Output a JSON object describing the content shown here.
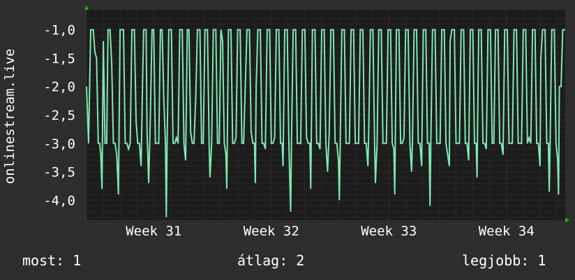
{
  "chart_data": {
    "type": "line",
    "ylabel": "onlinestream.live",
    "ylim": [
      -4.35,
      -0.65
    ],
    "yticks": [
      {
        "value": -1.0,
        "label": "-1,0"
      },
      {
        "value": -1.5,
        "label": "-1,5"
      },
      {
        "value": -2.0,
        "label": "-2,0"
      },
      {
        "value": -2.5,
        "label": "-2,5"
      },
      {
        "value": -3.0,
        "label": "-3,0"
      },
      {
        "value": -3.5,
        "label": "-3,5"
      },
      {
        "value": -4.0,
        "label": "-4,0"
      }
    ],
    "xlim": [
      0,
      28.5
    ],
    "xticks": [
      {
        "value": 4,
        "label": "Week 31"
      },
      {
        "value": 11,
        "label": "Week 32"
      },
      {
        "value": 18,
        "label": "Week 33"
      },
      {
        "value": 25,
        "label": "Week 34"
      }
    ],
    "grid": true,
    "colors": {
      "background": "#2d2d2d",
      "plot_background": "#1c1c1c",
      "line": "#7fe8b2",
      "grid_major": "#6b2a2a",
      "grid_minor": "#3a3a3a",
      "axis_arrow": "#00cc00"
    },
    "series": [
      {
        "values": [
          [
            0.0,
            -2.0
          ],
          [
            0.12,
            -3.0
          ],
          [
            0.25,
            -1.0
          ],
          [
            0.4,
            -1.0
          ],
          [
            0.5,
            -1.4
          ],
          [
            0.6,
            -1.5
          ],
          [
            0.7,
            -3.0
          ],
          [
            0.78,
            -3.0
          ],
          [
            0.85,
            -3.2
          ],
          [
            0.92,
            -3.8
          ],
          [
            1.0,
            -1.2
          ],
          [
            1.1,
            -3.0
          ],
          [
            1.2,
            -3.0
          ],
          [
            1.28,
            -1.0
          ],
          [
            1.4,
            -1.0
          ],
          [
            1.5,
            -1.6
          ],
          [
            1.6,
            -3.0
          ],
          [
            1.7,
            -3.0
          ],
          [
            1.8,
            -3.2
          ],
          [
            1.9,
            -3.9
          ],
          [
            2.0,
            -1.0
          ],
          [
            2.2,
            -1.0
          ],
          [
            2.3,
            -3.0
          ],
          [
            2.4,
            -3.0
          ],
          [
            2.5,
            -3.1
          ],
          [
            2.6,
            -3.0
          ],
          [
            2.7,
            -1.0
          ],
          [
            2.85,
            -1.0
          ],
          [
            2.95,
            -2.6
          ],
          [
            3.05,
            -3.0
          ],
          [
            3.15,
            -3.0
          ],
          [
            3.25,
            -3.4
          ],
          [
            3.32,
            -2.2
          ],
          [
            3.4,
            -1.0
          ],
          [
            3.55,
            -1.0
          ],
          [
            3.6,
            -2.8
          ],
          [
            3.7,
            -3.7
          ],
          [
            3.8,
            -2.5
          ],
          [
            3.9,
            -1.0
          ],
          [
            4.0,
            -1.0
          ],
          [
            4.1,
            -3.0
          ],
          [
            4.2,
            -3.0
          ],
          [
            4.3,
            -3.0
          ],
          [
            4.4,
            -1.0
          ],
          [
            4.5,
            -1.0
          ],
          [
            4.6,
            -2.2
          ],
          [
            4.7,
            -3.0
          ],
          [
            4.75,
            -4.3
          ],
          [
            4.8,
            -3.0
          ],
          [
            4.9,
            -1.0
          ],
          [
            5.05,
            -1.0
          ],
          [
            5.15,
            -3.0
          ],
          [
            5.25,
            -3.0
          ],
          [
            5.35,
            -2.9
          ],
          [
            5.45,
            -3.0
          ],
          [
            5.55,
            -1.0
          ],
          [
            5.7,
            -1.0
          ],
          [
            5.8,
            -3.0
          ],
          [
            5.9,
            -3.3
          ],
          [
            6.0,
            -1.0
          ],
          [
            6.1,
            -1.0
          ],
          [
            6.2,
            -2.8
          ],
          [
            6.3,
            -3.0
          ],
          [
            6.4,
            -3.0
          ],
          [
            6.5,
            -2.2
          ],
          [
            6.6,
            -1.0
          ],
          [
            6.75,
            -1.0
          ],
          [
            6.85,
            -3.0
          ],
          [
            6.95,
            -3.0
          ],
          [
            7.05,
            -1.0
          ],
          [
            7.2,
            -1.0
          ],
          [
            7.3,
            -3.0
          ],
          [
            7.35,
            -3.6
          ],
          [
            7.45,
            -3.0
          ],
          [
            7.55,
            -1.0
          ],
          [
            7.7,
            -1.0
          ],
          [
            7.8,
            -3.0
          ],
          [
            7.9,
            -3.0
          ],
          [
            8.0,
            -1.0
          ],
          [
            8.1,
            -1.2
          ],
          [
            8.2,
            -3.0
          ],
          [
            8.3,
            -3.2
          ],
          [
            8.35,
            -3.8
          ],
          [
            8.45,
            -1.0
          ],
          [
            8.6,
            -1.0
          ],
          [
            8.7,
            -3.0
          ],
          [
            8.8,
            -3.0
          ],
          [
            8.9,
            -2.9
          ],
          [
            9.0,
            -1.0
          ],
          [
            9.15,
            -1.0
          ],
          [
            9.25,
            -3.0
          ],
          [
            9.35,
            -3.0
          ],
          [
            9.45,
            -2.0
          ],
          [
            9.55,
            -1.0
          ],
          [
            9.7,
            -1.0
          ],
          [
            9.8,
            -2.8
          ],
          [
            9.9,
            -3.0
          ],
          [
            10.0,
            -3.0
          ],
          [
            10.05,
            -3.7
          ],
          [
            10.1,
            -2.0
          ],
          [
            10.2,
            -1.0
          ],
          [
            10.35,
            -1.0
          ],
          [
            10.45,
            -3.0
          ],
          [
            10.55,
            -3.0
          ],
          [
            10.65,
            -3.1
          ],
          [
            10.75,
            -1.0
          ],
          [
            10.9,
            -1.0
          ],
          [
            11.0,
            -3.0
          ],
          [
            11.1,
            -3.0
          ],
          [
            11.2,
            -2.9
          ],
          [
            11.3,
            -1.0
          ],
          [
            11.45,
            -1.0
          ],
          [
            11.55,
            -3.0
          ],
          [
            11.65,
            -3.0
          ],
          [
            11.7,
            -3.4
          ],
          [
            11.8,
            -1.0
          ],
          [
            11.95,
            -1.0
          ],
          [
            12.05,
            -3.0
          ],
          [
            12.15,
            -4.2
          ],
          [
            12.2,
            -3.0
          ],
          [
            12.3,
            -1.0
          ],
          [
            12.45,
            -1.0
          ],
          [
            12.55,
            -3.0
          ],
          [
            12.65,
            -3.0
          ],
          [
            12.75,
            -3.0
          ],
          [
            12.85,
            -1.0
          ],
          [
            13.0,
            -1.0
          ],
          [
            13.1,
            -2.9
          ],
          [
            13.2,
            -3.0
          ],
          [
            13.3,
            -3.0
          ],
          [
            13.35,
            -3.8
          ],
          [
            13.45,
            -1.0
          ],
          [
            13.6,
            -1.0
          ],
          [
            13.7,
            -3.0
          ],
          [
            13.8,
            -3.0
          ],
          [
            13.9,
            -3.1
          ],
          [
            14.0,
            -1.0
          ],
          [
            14.15,
            -1.0
          ],
          [
            14.25,
            -3.0
          ],
          [
            14.35,
            -3.5
          ],
          [
            14.45,
            -2.8
          ],
          [
            14.55,
            -1.0
          ],
          [
            14.7,
            -1.0
          ],
          [
            14.8,
            -3.0
          ],
          [
            14.9,
            -3.0
          ],
          [
            15.0,
            -3.3
          ],
          [
            15.05,
            -4.0
          ],
          [
            15.1,
            -3.0
          ],
          [
            15.2,
            -1.0
          ],
          [
            15.35,
            -1.0
          ],
          [
            15.45,
            -3.0
          ],
          [
            15.55,
            -3.0
          ],
          [
            15.65,
            -3.0
          ],
          [
            15.75,
            -1.0
          ],
          [
            15.9,
            -1.0
          ],
          [
            16.0,
            -3.0
          ],
          [
            16.1,
            -3.0
          ],
          [
            16.2,
            -3.0
          ],
          [
            16.3,
            -1.0
          ],
          [
            16.45,
            -1.0
          ],
          [
            16.55,
            -3.0
          ],
          [
            16.65,
            -3.0
          ],
          [
            16.75,
            -3.4
          ],
          [
            16.8,
            -2.8
          ],
          [
            16.9,
            -1.0
          ],
          [
            17.05,
            -1.0
          ],
          [
            17.15,
            -3.0
          ],
          [
            17.2,
            -3.7
          ],
          [
            17.3,
            -3.0
          ],
          [
            17.4,
            -1.0
          ],
          [
            17.55,
            -1.0
          ],
          [
            17.65,
            -3.0
          ],
          [
            17.75,
            -3.0
          ],
          [
            17.85,
            -3.0
          ],
          [
            17.95,
            -1.0
          ],
          [
            18.1,
            -1.0
          ],
          [
            18.2,
            -3.0
          ],
          [
            18.3,
            -3.1
          ],
          [
            18.35,
            -3.9
          ],
          [
            18.45,
            -1.0
          ],
          [
            18.6,
            -1.0
          ],
          [
            18.7,
            -3.0
          ],
          [
            18.8,
            -3.0
          ],
          [
            18.9,
            -2.9
          ],
          [
            19.0,
            -1.0
          ],
          [
            19.15,
            -1.0
          ],
          [
            19.25,
            -3.0
          ],
          [
            19.35,
            -3.5
          ],
          [
            19.4,
            -3.0
          ],
          [
            19.5,
            -1.0
          ],
          [
            19.65,
            -1.0
          ],
          [
            19.75,
            -3.0
          ],
          [
            19.85,
            -3.0
          ],
          [
            19.95,
            -3.4
          ],
          [
            20.05,
            -1.0
          ],
          [
            20.2,
            -1.0
          ],
          [
            20.3,
            -3.0
          ],
          [
            20.4,
            -3.0
          ],
          [
            20.45,
            -4.1
          ],
          [
            20.5,
            -3.0
          ],
          [
            20.6,
            -1.0
          ],
          [
            20.75,
            -1.0
          ],
          [
            20.85,
            -3.0
          ],
          [
            20.95,
            -3.0
          ],
          [
            21.05,
            -3.0
          ],
          [
            21.15,
            -1.0
          ],
          [
            21.3,
            -1.0
          ],
          [
            21.4,
            -3.0
          ],
          [
            21.5,
            -3.2
          ],
          [
            21.6,
            -3.4
          ],
          [
            21.65,
            -1.2
          ],
          [
            21.75,
            -1.0
          ],
          [
            21.9,
            -1.0
          ],
          [
            22.0,
            -3.0
          ],
          [
            22.1,
            -3.0
          ],
          [
            22.2,
            -3.0
          ],
          [
            22.3,
            -1.0
          ],
          [
            22.45,
            -1.0
          ],
          [
            22.55,
            -3.0
          ],
          [
            22.65,
            -3.0
          ],
          [
            22.75,
            -3.3
          ],
          [
            22.85,
            -1.0
          ],
          [
            23.0,
            -1.0
          ],
          [
            23.1,
            -3.0
          ],
          [
            23.2,
            -3.0
          ],
          [
            23.25,
            -3.6
          ],
          [
            23.35,
            -1.0
          ],
          [
            23.5,
            -1.0
          ],
          [
            23.6,
            -3.0
          ],
          [
            23.7,
            -3.0
          ],
          [
            23.8,
            -3.1
          ],
          [
            23.9,
            -1.0
          ],
          [
            24.05,
            -1.0
          ],
          [
            24.15,
            -3.0
          ],
          [
            24.25,
            -3.0
          ],
          [
            24.35,
            -1.0
          ],
          [
            24.5,
            -1.0
          ],
          [
            24.6,
            -3.0
          ],
          [
            24.7,
            -3.0
          ],
          [
            24.8,
            -3.2
          ],
          [
            24.9,
            -1.0
          ],
          [
            25.05,
            -1.0
          ],
          [
            25.15,
            -3.0
          ],
          [
            25.25,
            -3.0
          ],
          [
            25.35,
            -3.0
          ],
          [
            25.45,
            -1.0
          ],
          [
            25.6,
            -1.0
          ],
          [
            25.7,
            -3.0
          ],
          [
            25.8,
            -3.0
          ],
          [
            25.9,
            -3.0
          ],
          [
            26.0,
            -1.0
          ],
          [
            26.15,
            -1.0
          ],
          [
            26.25,
            -3.0
          ],
          [
            26.35,
            -2.9
          ],
          [
            26.45,
            -3.0
          ],
          [
            26.55,
            -1.0
          ],
          [
            26.7,
            -1.0
          ],
          [
            26.8,
            -3.0
          ],
          [
            26.9,
            -3.0
          ],
          [
            27.0,
            -3.4
          ],
          [
            27.05,
            -1.5
          ],
          [
            27.15,
            -1.0
          ],
          [
            27.3,
            -1.0
          ],
          [
            27.4,
            -3.0
          ],
          [
            27.5,
            -3.0
          ],
          [
            27.55,
            -3.85
          ],
          [
            27.6,
            -3.0
          ],
          [
            27.7,
            -1.0
          ],
          [
            27.85,
            -1.0
          ],
          [
            27.95,
            -3.0
          ],
          [
            28.05,
            -3.3
          ],
          [
            28.1,
            -3.9
          ],
          [
            28.15,
            -2.0
          ],
          [
            28.25,
            -2.0
          ],
          [
            28.35,
            -1.0
          ],
          [
            28.5,
            -1.0
          ]
        ]
      }
    ]
  },
  "legend": {
    "current": "most: 1",
    "average": "átlag: 2",
    "best": "legjobb: 1"
  }
}
